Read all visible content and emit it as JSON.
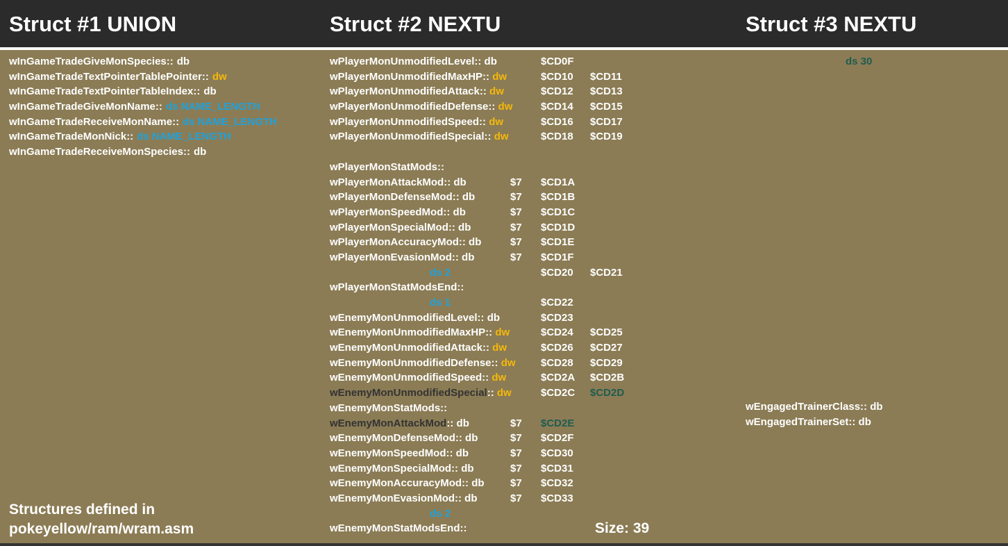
{
  "headers": {
    "struct1": "Struct #1 UNION",
    "struct2": "Struct #2 NEXTU",
    "struct3": "Struct #3 NEXTU"
  },
  "col1": [
    {
      "label": "wInGameTradeGiveMonSpecies::",
      "dir": "db"
    },
    {
      "label": "wInGameTradeTextPointerTablePointer::",
      "dir": "dw"
    },
    {
      "label": "wInGameTradeTextPointerTableIndex::",
      "dir": "db"
    },
    {
      "label": "wInGameTradeGiveMonName::",
      "dir": "ds NAME_LENGTH"
    },
    {
      "label": "wInGameTradeReceiveMonName::",
      "dir": "ds NAME_LENGTH"
    },
    {
      "label": "wInGameTradeMonNick::",
      "dir": "ds NAME_LENGTH"
    },
    {
      "label": "wInGameTradeReceiveMonSpecies::",
      "dir": "db"
    }
  ],
  "col2": [
    {
      "a": "wPlayerMonUnmodifiedLevel::",
      "b": " db",
      "bc": "",
      "v": "",
      "a1": "$CD0F",
      "a2": ""
    },
    {
      "a": "wPlayerMonUnmodifiedMaxHP::",
      "b": " dw",
      "bc": "dw",
      "v": "",
      "a1": "$CD10",
      "a2": "$CD11"
    },
    {
      "a": "wPlayerMonUnmodifiedAttack::",
      "b": " dw",
      "bc": "dw",
      "v": "",
      "a1": "$CD12",
      "a2": "$CD13"
    },
    {
      "a": "wPlayerMonUnmodifiedDefense::",
      "b": " dw",
      "bc": "dw",
      "v": "",
      "a1": "$CD14",
      "a2": "$CD15"
    },
    {
      "a": "wPlayerMonUnmodifiedSpeed::",
      "b": " dw",
      "bc": "dw",
      "v": "",
      "a1": "$CD16",
      "a2": "$CD17"
    },
    {
      "a": "wPlayerMonUnmodifiedSpecial::",
      "b": " dw",
      "bc": "dw",
      "v": "",
      "a1": "$CD18",
      "a2": "$CD19"
    },
    {
      "a": "",
      "b": "",
      "bc": "",
      "v": "",
      "a1": "",
      "a2": ""
    },
    {
      "a": "wPlayerMonStatMods::",
      "b": "",
      "bc": "",
      "v": "",
      "a1": "",
      "a2": ""
    },
    {
      "a": "wPlayerMonAttackMod::",
      "b": " db",
      "bc": "",
      "v": "$7",
      "a1": "$CD1A",
      "a2": ""
    },
    {
      "a": "wPlayerMonDefenseMod::",
      "b": " db",
      "bc": "",
      "v": "$7",
      "a1": "$CD1B",
      "a2": ""
    },
    {
      "a": "wPlayerMonSpeedMod::",
      "b": " db",
      "bc": "",
      "v": "$7",
      "a1": "$CD1C",
      "a2": ""
    },
    {
      "a": "wPlayerMonSpecialMod::",
      "b": " db",
      "bc": "",
      "v": "$7",
      "a1": "$CD1D",
      "a2": ""
    },
    {
      "a": "wPlayerMonAccuracyMod::",
      "b": " db",
      "bc": "",
      "v": "$7",
      "a1": "$CD1E",
      "a2": ""
    },
    {
      "a": "wPlayerMonEvasionMod::",
      "b": " db",
      "bc": "",
      "v": "$7",
      "a1": "$CD1F",
      "a2": ""
    },
    {
      "ds": "ds 2",
      "a": "",
      "b": "",
      "bc": "",
      "v": "",
      "a1": "$CD20",
      "a2": "$CD21"
    },
    {
      "a": "wPlayerMonStatModsEnd::",
      "b": "",
      "bc": "",
      "v": "",
      "a1": "",
      "a2": ""
    },
    {
      "ds": "ds 1",
      "a": "",
      "b": "",
      "bc": "",
      "v": "",
      "a1": "$CD22",
      "a2": ""
    },
    {
      "a": "wEnemyMonUnmodifiedLevel::",
      "b": " db",
      "bc": "",
      "v": "",
      "a1": "$CD23",
      "a2": ""
    },
    {
      "a": "wEnemyMonUnmodifiedMaxHP::",
      "b": " dw",
      "bc": "dw",
      "v": "",
      "a1": "$CD24",
      "a2": "$CD25"
    },
    {
      "a": "wEnemyMonUnmodifiedAttack::",
      "b": " dw",
      "bc": "dw",
      "v": "",
      "a1": "$CD26",
      "a2": "$CD27"
    },
    {
      "a": "wEnemyMonUnmodifiedDefense::",
      "b": " dw",
      "bc": "dw",
      "v": "",
      "a1": "$CD28",
      "a2": "$CD29"
    },
    {
      "a": "wEnemyMonUnmodifiedSpeed::",
      "b": " dw",
      "bc": "dw",
      "v": "",
      "a1": "$CD2A",
      "a2": "$CD2B"
    },
    {
      "a": "wEnemyMonUnmodifiedSpecial",
      "ac": "dk",
      "a_tail": "::",
      "b": " dw",
      "bc": "dw",
      "v": "",
      "a1": "$CD2C",
      "a2": "$CD2D",
      "a2c": "tl"
    },
    {
      "a": "wEnemyMonStatMods::",
      "b": "",
      "bc": "",
      "v": "",
      "a1": "",
      "a2": ""
    },
    {
      "a": "wEnemyMonAttackMod",
      "ac": "dk",
      "a_tail": "::",
      "b": " db",
      "bc": "",
      "v": "$7",
      "a1": "$CD2E",
      "a1c": "tl",
      "a2": ""
    },
    {
      "a": "wEnemyMonDefenseMod::",
      "b": " db",
      "bc": "",
      "v": "$7",
      "a1": "$CD2F",
      "a2": ""
    },
    {
      "a": "wEnemyMonSpeedMod::",
      "b": " db",
      "bc": "",
      "v": "$7",
      "a1": "$CD30",
      "a2": ""
    },
    {
      "a": "wEnemyMonSpecialMod::",
      "b": " db",
      "bc": "",
      "v": "$7",
      "a1": "$CD31",
      "a2": ""
    },
    {
      "a": "wEnemyMonAccuracyMod::",
      "b": " db",
      "bc": "",
      "v": "$7",
      "a1": "$CD32",
      "a2": ""
    },
    {
      "a": "wEnemyMonEvasionMod::",
      "b": " db",
      "bc": "",
      "v": "$7",
      "a1": "$CD33",
      "a2": ""
    },
    {
      "ds": "ds 2",
      "a": "",
      "b": "",
      "bc": "",
      "v": "",
      "a1": "",
      "a2": ""
    },
    {
      "a": "wEnemyMonStatModsEnd::",
      "b": "",
      "bc": "",
      "v": "",
      "a1": "",
      "a2": ""
    }
  ],
  "col3": {
    "ds30": "ds 30",
    "labels": [
      {
        "label": "wEngagedTrainerClass::",
        "dir": " db"
      },
      {
        "label": "wEngagedTrainerSet::",
        "dir": " db"
      }
    ]
  },
  "footer": {
    "note_line1": "Structures defined in",
    "note_line2": "pokeyellow/ram/wram.asm",
    "size": "Size: 39"
  },
  "colors": {
    "background": "#8b7c55",
    "header_bg": "#2b2b2b",
    "dw": "#f5b80c",
    "ds": "#1fa2dc",
    "highlight_dark": "#333333",
    "address_teal": "#1f5c4f"
  }
}
